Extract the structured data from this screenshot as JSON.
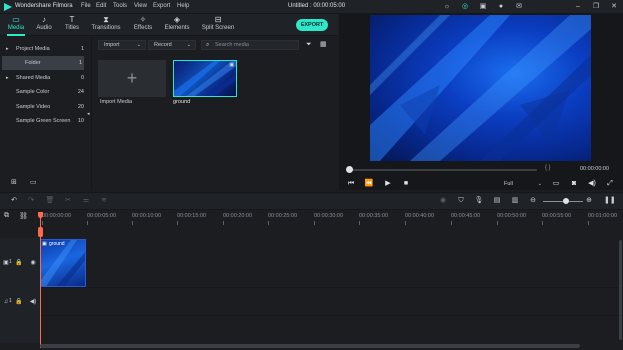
{
  "app": {
    "name": "Wondershare Filmora",
    "menu": [
      "File",
      "Edit",
      "Tools",
      "View",
      "Export",
      "Help"
    ],
    "project_title": "Untitled : 00:00:05:00",
    "titlebar_icons": [
      "lightbulb-icon",
      "headset-icon",
      "gift-icon",
      "account-icon",
      "mail-icon",
      "minimize-icon",
      "restore-icon",
      "close-icon"
    ]
  },
  "tabs": [
    {
      "label": "Media",
      "icon": "folder-icon",
      "active": true
    },
    {
      "label": "Audio",
      "icon": "music-note-icon",
      "active": false
    },
    {
      "label": "Titles",
      "icon": "text-icon",
      "active": false
    },
    {
      "label": "Transitions",
      "icon": "transitions-icon",
      "active": false
    },
    {
      "label": "Effects",
      "icon": "effects-icon",
      "active": false
    },
    {
      "label": "Elements",
      "icon": "elements-icon",
      "active": false
    },
    {
      "label": "Split Screen",
      "icon": "split-screen-icon",
      "active": false
    }
  ],
  "export_label": "EXPORT",
  "library": {
    "items": [
      {
        "label": "Project Media",
        "count": "1",
        "expandable": true,
        "selected": false
      },
      {
        "label": "Folder",
        "count": "1",
        "expandable": false,
        "selected": true
      },
      {
        "label": "Shared Media",
        "count": "0",
        "expandable": true,
        "selected": false
      },
      {
        "label": "Sample Color",
        "count": "24",
        "expandable": false,
        "selected": false
      },
      {
        "label": "Sample Video",
        "count": "20",
        "expandable": false,
        "selected": false
      },
      {
        "label": "Sample Green Screen",
        "count": "10",
        "expandable": false,
        "selected": false
      }
    ]
  },
  "media": {
    "import_dropdown": "Import",
    "record_dropdown": "Record",
    "search_placeholder": "Search media",
    "import_tile_label": "Import Media",
    "items": [
      {
        "label": "ground"
      }
    ]
  },
  "preview": {
    "brackets": "{    }",
    "time": "00:00:00:00",
    "quality": "Full"
  },
  "timeline": {
    "ruler_ticks": [
      "00:00:00:00",
      "00:00:05:00",
      "00:00:10:00",
      "00:00:15:00",
      "00:00:20:00",
      "00:00:25:00",
      "00:00:30:00",
      "00:00:35:00",
      "00:00:40:00",
      "00:00:45:00",
      "00:00:50:00",
      "00:00:55:00",
      "00:01:00:00"
    ],
    "clip_label": "ground",
    "video_track_label": "1",
    "audio_track_label": "1"
  },
  "colors": {
    "accent": "#2ee6c8",
    "playhead": "#ff6b4a",
    "background": "#1b1d21"
  }
}
